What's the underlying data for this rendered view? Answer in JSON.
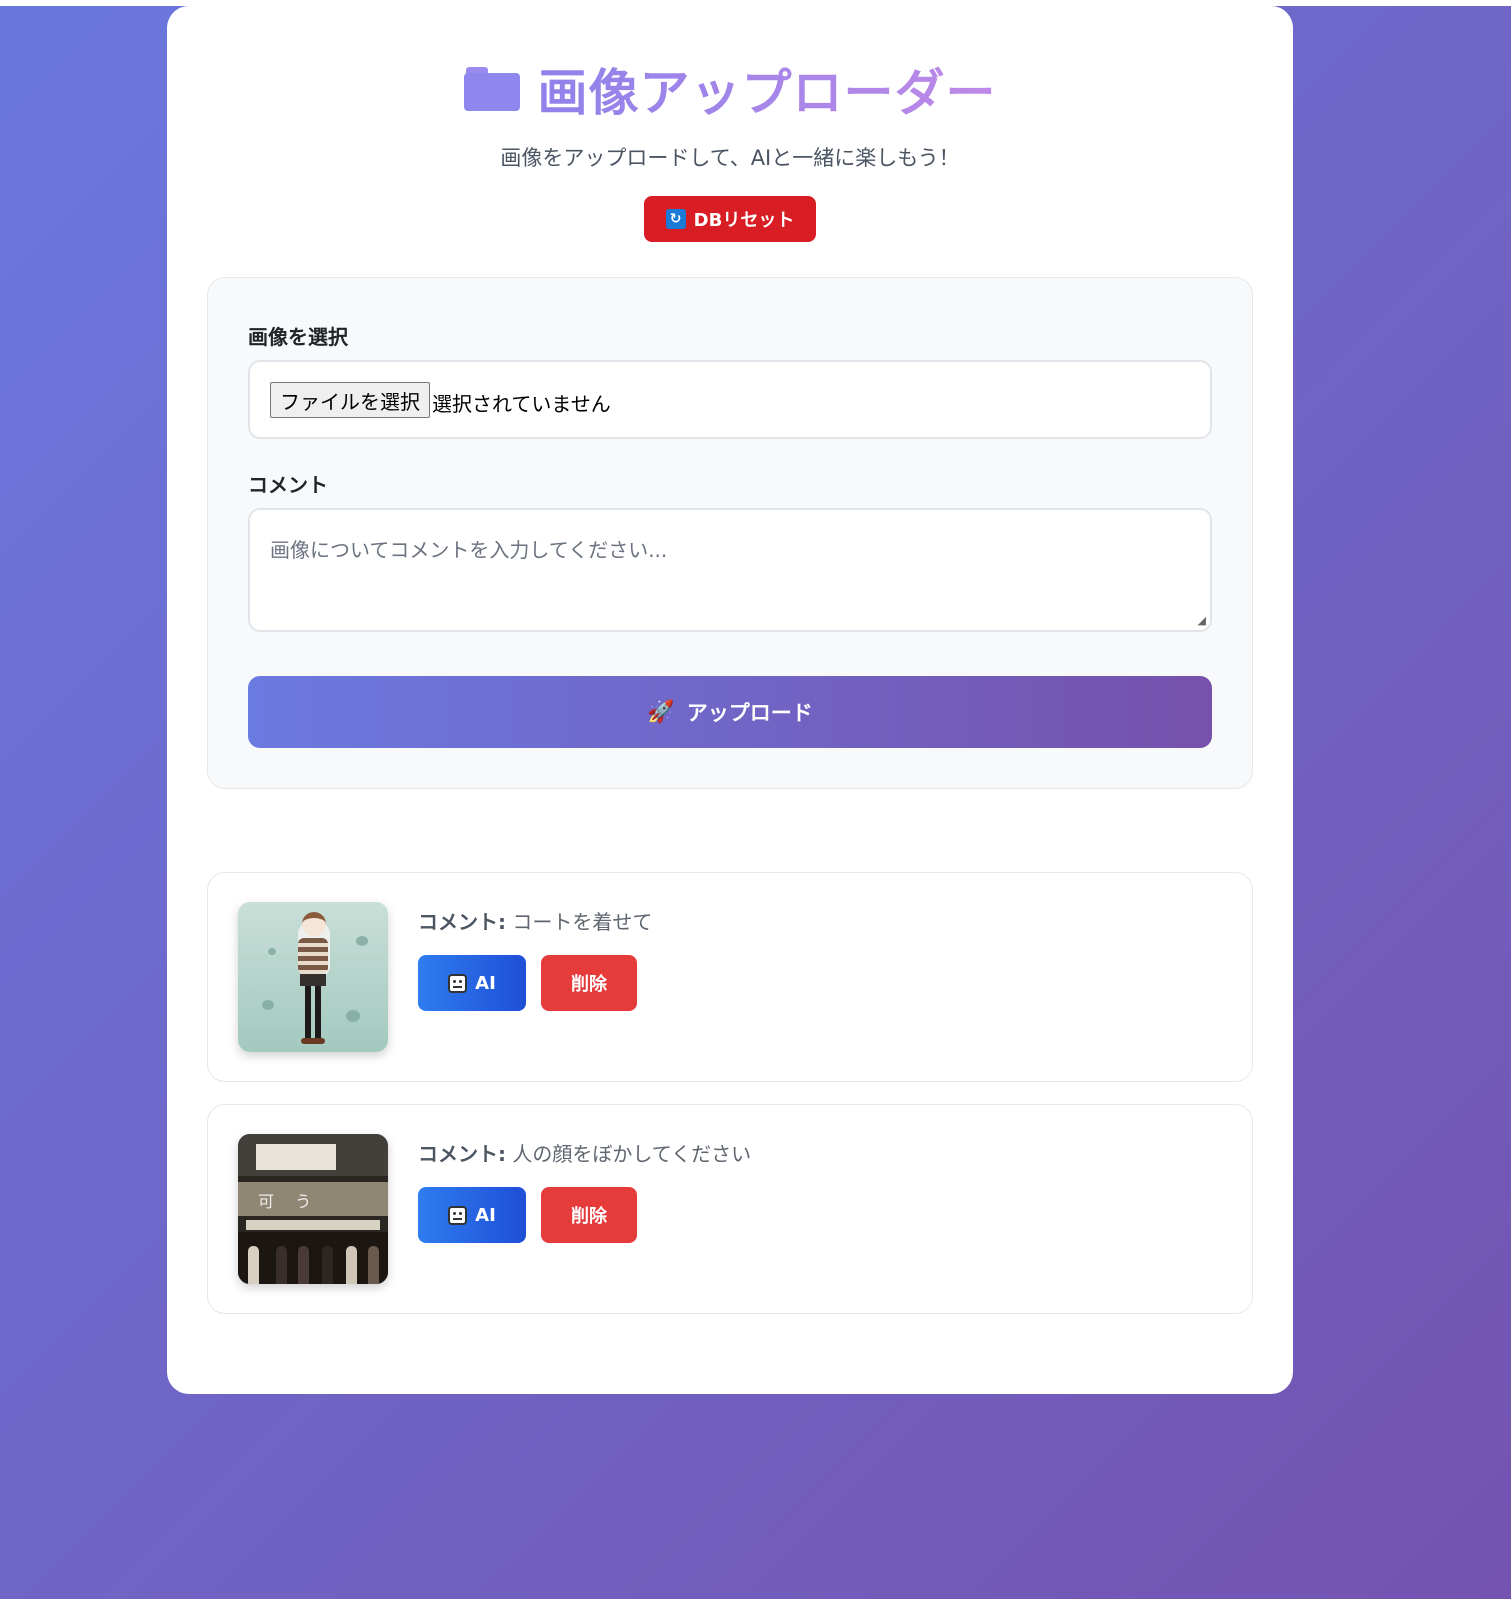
{
  "header": {
    "title": "画像アップローダー",
    "subtitle": "画像をアップロードして、AIと一緒に楽しもう！",
    "reset_label": "DBリセット",
    "title_icon": "folder-icon",
    "reset_icon": "sync-icon"
  },
  "form": {
    "image_label": "画像を選択",
    "file_button_label": "ファイルを選択",
    "file_status": "選択されていません",
    "comment_label": "コメント",
    "comment_placeholder": "画像についてコメントを入力してください...",
    "upload_label": "アップロード",
    "upload_icon": "rocket-icon"
  },
  "items": [
    {
      "comment_label": "コメント:",
      "comment": "コートを着せて",
      "ai_label": "AI",
      "delete_label": "削除"
    },
    {
      "comment_label": "コメント:",
      "comment": "人の顔をぼかしてください",
      "ai_label": "AI",
      "delete_label": "削除"
    }
  ],
  "colors": {
    "background_start": "#6a78de",
    "background_end": "#7453b0",
    "reset_button": "#d81e24",
    "ai_button": "#2f7cf0",
    "delete_button": "#e53b3b"
  }
}
